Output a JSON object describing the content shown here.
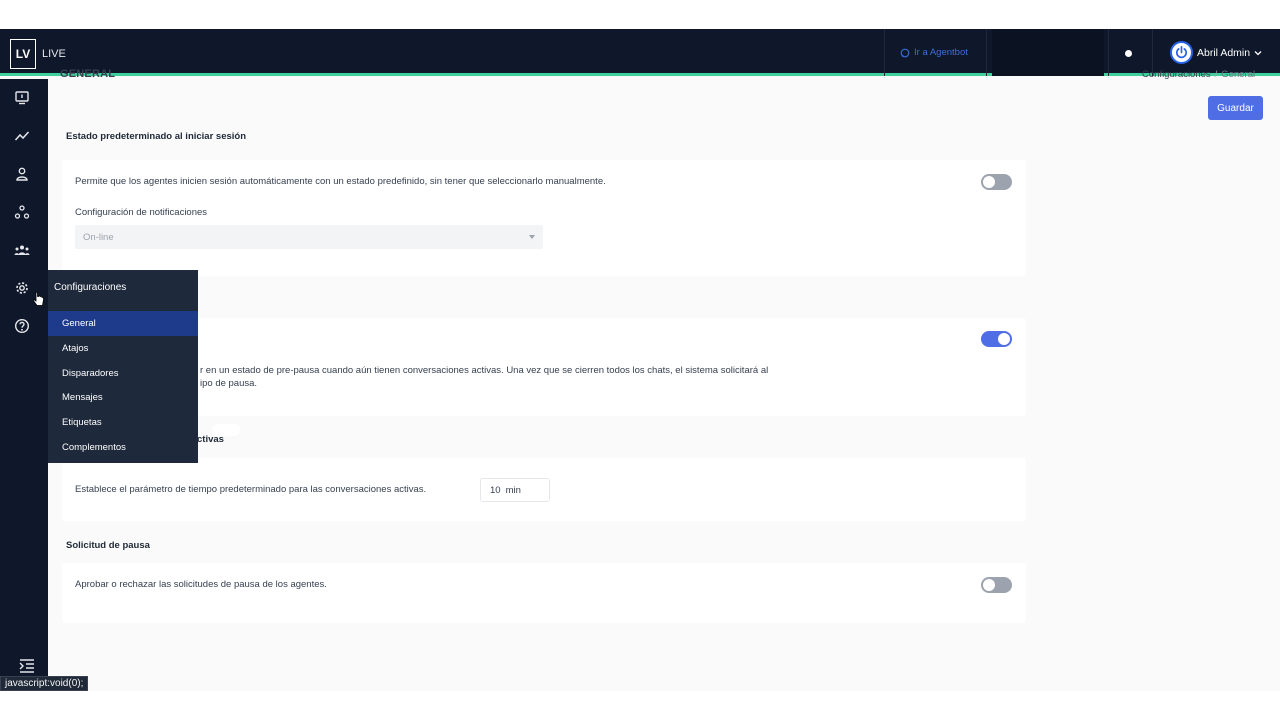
{
  "app": {
    "logo": "LV",
    "name": "LIVE"
  },
  "topbar": {
    "agentbot_link": "Ir a Agentbot",
    "user_name": "Abril Admin"
  },
  "rail": {
    "icons": [
      "monitor-icon",
      "trend-icon",
      "user-icon",
      "network-icon",
      "team-icon",
      "gear-icon",
      "help-icon",
      "list-indent-icon"
    ]
  },
  "page": {
    "title": "GENERAL",
    "breadcrumb": {
      "parent": "Configuraciones",
      "separator": "/",
      "current": "General"
    },
    "save_label": "Guardar"
  },
  "sections": {
    "default_state": {
      "heading": "Estado predeterminado al iniciar sesión",
      "description": "Permite que los agentes inicien sesión automáticamente con un estado predefinido, sin tener que seleccionarlo manualmente.",
      "toggle_on": false,
      "notif_label": "Configuración de notificaciones",
      "select_value": "On-line"
    },
    "pre_pause": {
      "line1": "r en un estado de pre-pausa cuando aún tienen conversaciones activas. Una vez que se cierren todos los chats, el sistema solicitará al",
      "line2": "ipo de pausa.",
      "toggle_on": true
    },
    "active_conversations": {
      "heading_fragment": "ctivas",
      "description": "Establece el parámetro de tiempo predeterminado para las conversaciones activas.",
      "minutes_value": "10",
      "minutes_unit": "min"
    },
    "pause_request": {
      "heading": "Solicitud de pausa",
      "description": "Aprobar o rechazar las solicitudes de pausa de los agentes.",
      "toggle_on": false
    }
  },
  "flyout": {
    "title": "Configuraciones",
    "items": [
      "General",
      "Atajos",
      "Disparadores",
      "Mensajes",
      "Etiquetas",
      "Complementos"
    ],
    "active_index": 0
  },
  "status_bar": "javascript:void(0);",
  "colors": {
    "accent": "#4f6ee6",
    "topbar": "#0f172a",
    "topbar_border": "#3ecf9a",
    "flyout": "#1e293b",
    "flyout_active": "#1e3a8a"
  }
}
